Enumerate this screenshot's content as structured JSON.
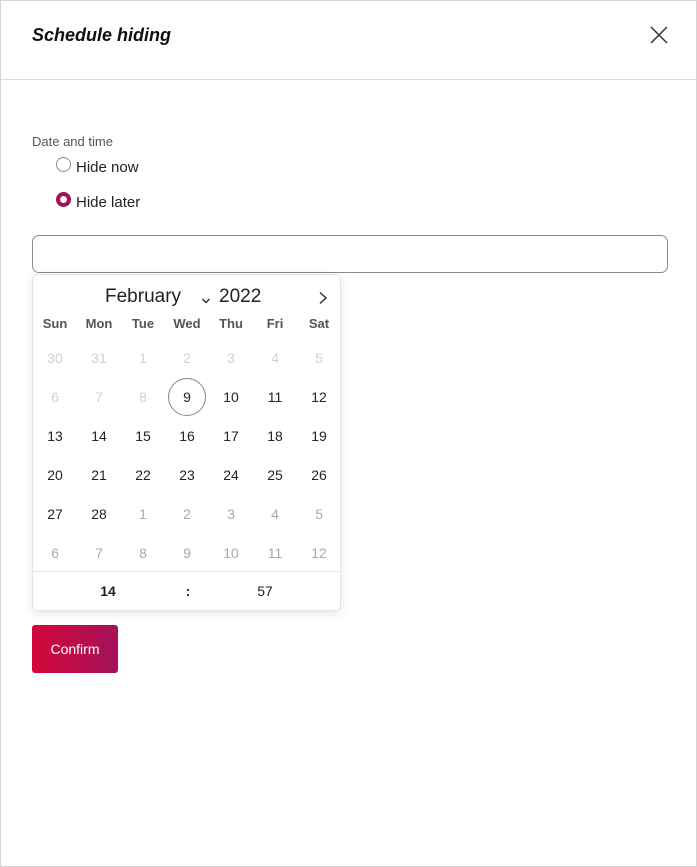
{
  "dialog": {
    "title": "Schedule hiding",
    "close_icon": "close-icon"
  },
  "form": {
    "field_label": "Date and time",
    "options": [
      {
        "label": "Hide now",
        "checked": false
      },
      {
        "label": "Hide later",
        "checked": true
      }
    ],
    "datetime_value": "",
    "datetime_placeholder": ""
  },
  "calendar": {
    "month": "February",
    "year": "2022",
    "next_icon": "chevron-right-icon",
    "month_dropdown_icon": "chevron-down-icon",
    "weekdays": [
      "Sun",
      "Mon",
      "Tue",
      "Wed",
      "Thu",
      "Fri",
      "Sat"
    ],
    "weeks": [
      [
        {
          "d": "30",
          "s": "disabled"
        },
        {
          "d": "31",
          "s": "disabled"
        },
        {
          "d": "1",
          "s": "disabled"
        },
        {
          "d": "2",
          "s": "disabled"
        },
        {
          "d": "3",
          "s": "disabled"
        },
        {
          "d": "4",
          "s": "disabled"
        },
        {
          "d": "5",
          "s": "disabled"
        }
      ],
      [
        {
          "d": "6",
          "s": "disabled"
        },
        {
          "d": "7",
          "s": "disabled"
        },
        {
          "d": "8",
          "s": "disabled"
        },
        {
          "d": "9",
          "s": "today"
        },
        {
          "d": "10",
          "s": "normal"
        },
        {
          "d": "11",
          "s": "normal"
        },
        {
          "d": "12",
          "s": "normal"
        }
      ],
      [
        {
          "d": "13",
          "s": "normal"
        },
        {
          "d": "14",
          "s": "normal"
        },
        {
          "d": "15",
          "s": "normal"
        },
        {
          "d": "16",
          "s": "normal"
        },
        {
          "d": "17",
          "s": "normal"
        },
        {
          "d": "18",
          "s": "normal"
        },
        {
          "d": "19",
          "s": "normal"
        }
      ],
      [
        {
          "d": "20",
          "s": "normal"
        },
        {
          "d": "21",
          "s": "normal"
        },
        {
          "d": "22",
          "s": "normal"
        },
        {
          "d": "23",
          "s": "normal"
        },
        {
          "d": "24",
          "s": "normal"
        },
        {
          "d": "25",
          "s": "normal"
        },
        {
          "d": "26",
          "s": "normal"
        }
      ],
      [
        {
          "d": "27",
          "s": "normal"
        },
        {
          "d": "28",
          "s": "normal"
        },
        {
          "d": "1",
          "s": "other"
        },
        {
          "d": "2",
          "s": "other"
        },
        {
          "d": "3",
          "s": "other"
        },
        {
          "d": "4",
          "s": "other"
        },
        {
          "d": "5",
          "s": "other"
        }
      ],
      [
        {
          "d": "6",
          "s": "other"
        },
        {
          "d": "7",
          "s": "other"
        },
        {
          "d": "8",
          "s": "other"
        },
        {
          "d": "9",
          "s": "other"
        },
        {
          "d": "10",
          "s": "other"
        },
        {
          "d": "11",
          "s": "other"
        },
        {
          "d": "12",
          "s": "other"
        }
      ]
    ],
    "time": {
      "hour": "14",
      "separator": ":",
      "minute": "57"
    }
  },
  "actions": {
    "confirm_label": "Confirm"
  },
  "colors": {
    "accent": "#a3124f",
    "button_gradient_start": "#d3083b",
    "button_gradient_end": "#a3125a"
  }
}
